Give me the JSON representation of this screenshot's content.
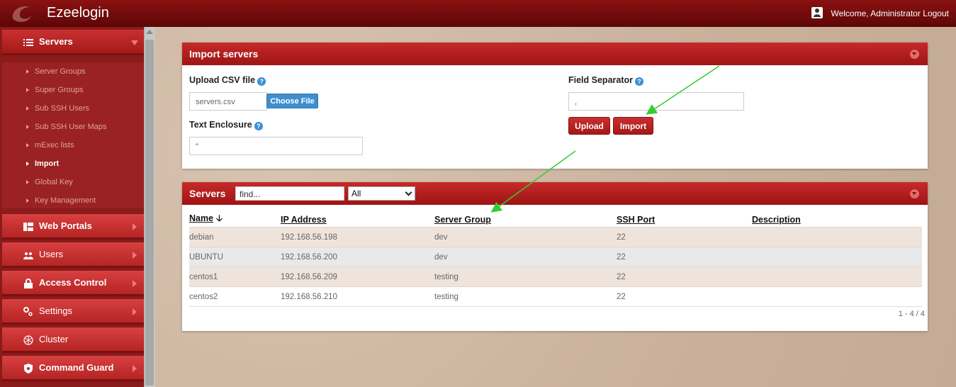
{
  "header": {
    "app_title": "Ezeelogin",
    "welcome_text": "Welcome, Administrator Logout"
  },
  "sidebar": {
    "servers_label": "Servers",
    "sub_items": [
      {
        "label": "Server Groups"
      },
      {
        "label": "Super Groups"
      },
      {
        "label": "Sub SSH Users"
      },
      {
        "label": "Sub SSH User Maps"
      },
      {
        "label": "mExec lists"
      },
      {
        "label": "Import"
      },
      {
        "label": "Global Key"
      },
      {
        "label": "Key Management"
      }
    ],
    "menus": [
      {
        "label": "Web Portals"
      },
      {
        "label": "Users"
      },
      {
        "label": "Access Control"
      },
      {
        "label": "Settings"
      },
      {
        "label": "Cluster"
      },
      {
        "label": "Command Guard"
      }
    ]
  },
  "import_panel": {
    "title": "Import servers",
    "upload_label": "Upload CSV file",
    "file_name": "servers.csv",
    "choose_label": "Choose File",
    "enclosure_label": "Text Enclosure",
    "enclosure_value": "\"",
    "separator_label": "Field Separator",
    "separator_value": ",",
    "upload_btn": "Upload",
    "import_btn": "Import"
  },
  "servers_panel": {
    "title": "Servers",
    "search_value": "find...",
    "filter_value": "All",
    "columns": {
      "name": "Name",
      "ip": "IP Address",
      "group": "Server Group",
      "port": "SSH Port",
      "description": "Description"
    },
    "rows": [
      {
        "name": "debian",
        "ip": "192.168.56.198",
        "group": "dev",
        "port": "22",
        "description": ""
      },
      {
        "name": "UBUNTU",
        "ip": "192.168.56.200",
        "group": "dev",
        "port": "22",
        "description": ""
      },
      {
        "name": "centos1",
        "ip": "192.168.56.209",
        "group": "testing",
        "port": "22",
        "description": ""
      },
      {
        "name": "centos2",
        "ip": "192.168.56.210",
        "group": "testing",
        "port": "22",
        "description": ""
      }
    ],
    "pager": "1 - 4 / 4"
  },
  "colors": {
    "brand_red": "#b52424",
    "annotation_arrow": "#33cc33",
    "choose_button": "#3d8fcf"
  }
}
